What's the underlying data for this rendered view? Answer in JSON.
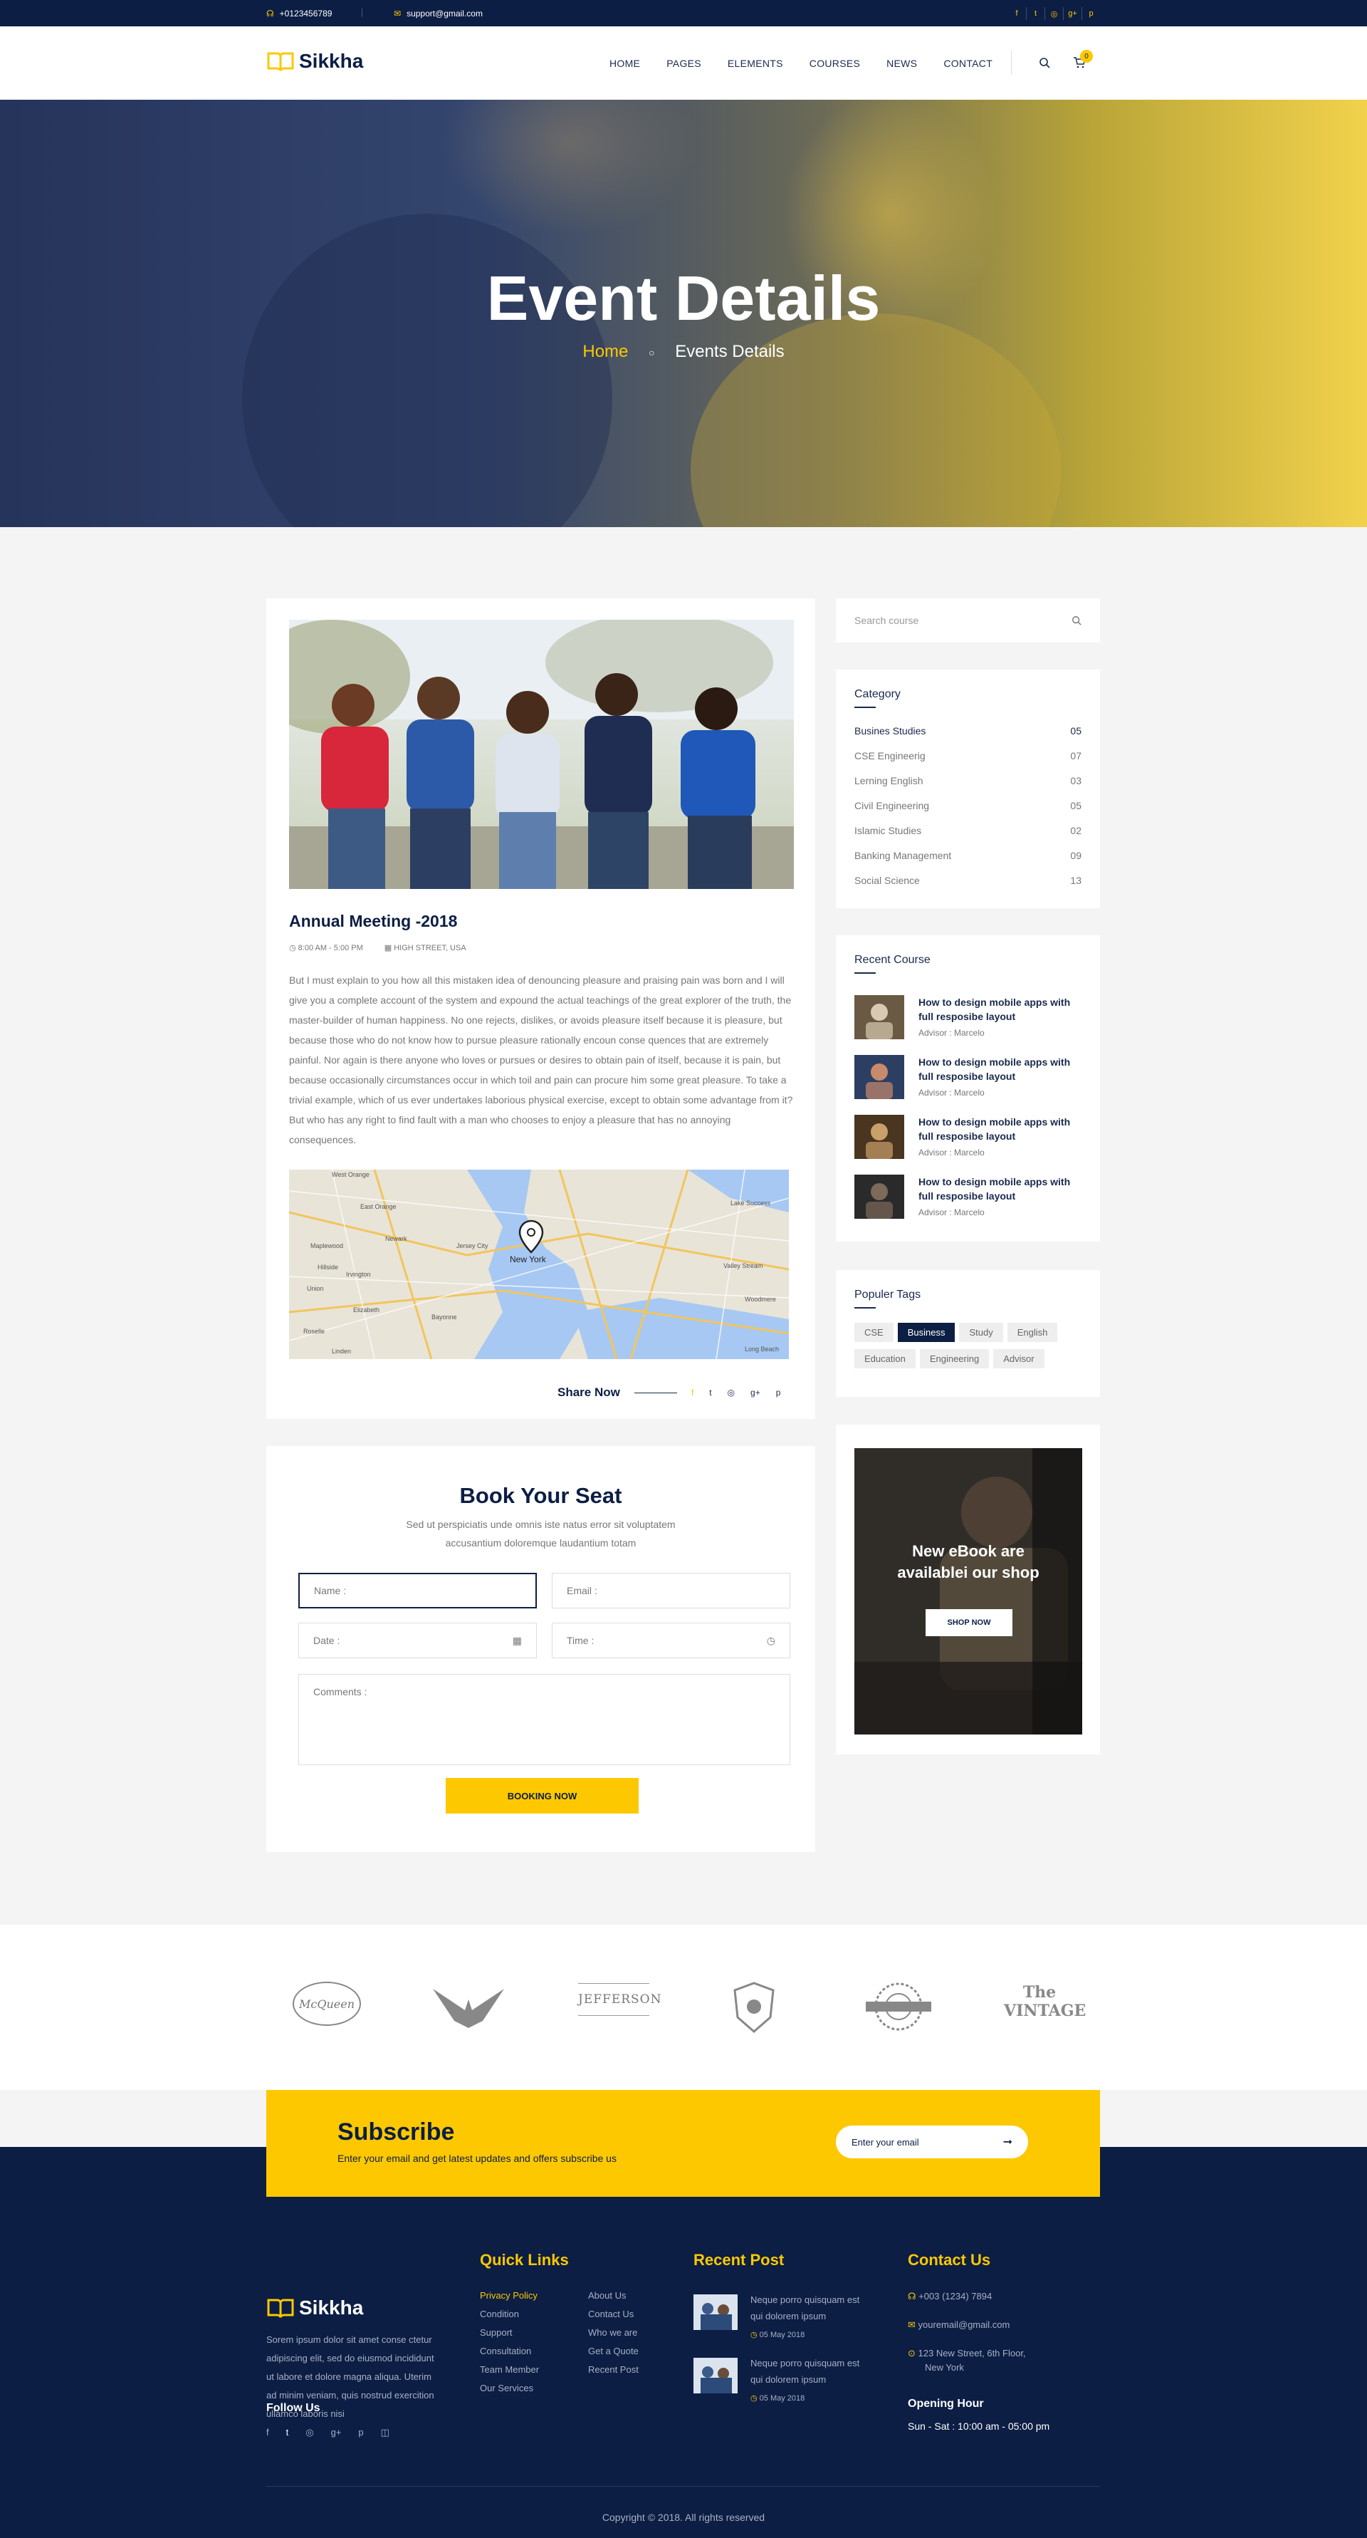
{
  "topbar": {
    "phone": "+0123456789",
    "email": "support@gmail.com",
    "social_icons": [
      "facebook-icon",
      "twitter-icon",
      "dribbble-icon",
      "google-plus-icon",
      "pinterest-icon"
    ]
  },
  "header": {
    "logo": "Sikkha",
    "nav": [
      "HOME",
      "PAGES",
      "ELEMENTS",
      "COURSES",
      "NEWS",
      "CONTACT"
    ],
    "cart_count": "0"
  },
  "hero": {
    "title": "Event Details",
    "crumb_home": "Home",
    "crumb_current": "Events Details"
  },
  "event": {
    "title": "Annual Meeting -2018",
    "time": "8:00 AM - 5:00 PM",
    "location": "HIGH STREET, USA",
    "body": "But I must explain to you how all this mistaken idea of denouncing pleasure and praising pain was born and I will give you a complete account of the system and expound the actual teachings of the great explorer of the truth, the master-builder of human happiness. No one rejects, dislikes, or avoids pleasure itself because it is pleasure, but because those who do not know how to pursue pleasure rationally encoun conse quences that are extremely painful. Nor again is there anyone who loves or pursues or desires to obtain pain of itself, because it is pain, but because occasionally circumstances occur in which toil and pain can procure him some great pleasure. To take a trivial example, which of us ever undertakes laborious physical exercise, except to obtain some advantage from it? But who has any right to find fault with a man who chooses to enjoy a pleasure that has no annoying consequences.",
    "map_labels": [
      "West Orange",
      "East Orange",
      "Newark",
      "Maplewood",
      "Irvington",
      "Elizabeth",
      "Jersey City",
      "New York",
      "Bayonne",
      "Linden",
      "Lake Success",
      "Valley Stream",
      "Woodmere",
      "Long Beach",
      "Roselle",
      "Union",
      "Hillside"
    ],
    "share_label": "Share Now"
  },
  "booking": {
    "title": "Book Your Seat",
    "desc1": "Sed ut perspiciatis unde omnis iste natus error sit voluptatem",
    "desc2": "accusantium doloremque laudantium totam",
    "name_ph": "Name :",
    "email_ph": "Email :",
    "date_ph": "Date :",
    "time_ph": "Time :",
    "comments_ph": "Comments :",
    "button": "BOOKING NOW"
  },
  "sidebar": {
    "search_ph": "Search course",
    "category_title": "Category",
    "categories": [
      {
        "name": "Busines Studies",
        "count": "05"
      },
      {
        "name": "CSE Engineerig",
        "count": "07"
      },
      {
        "name": "Lerning English",
        "count": "03"
      },
      {
        "name": "Civil Engineering",
        "count": "05"
      },
      {
        "name": "Islamic Studies",
        "count": "02"
      },
      {
        "name": "Banking Management",
        "count": "09"
      },
      {
        "name": "Social Science",
        "count": "13"
      }
    ],
    "recent_title": "Recent Course",
    "recent": [
      {
        "title1": "How to design mobile apps with",
        "title2": "full resposibe layout",
        "advisor": "Advisor : Marcelo"
      },
      {
        "title1": "How to design mobile apps with",
        "title2": "full resposibe layout",
        "advisor": "Advisor : Marcelo"
      },
      {
        "title1": "How to design mobile apps with",
        "title2": "full resposibe layout",
        "advisor": "Advisor : Marcelo"
      },
      {
        "title1": "How to design mobile apps with",
        "title2": "full resposibe layout",
        "advisor": "Advisor : Marcelo"
      }
    ],
    "tags_title": "Populer Tags",
    "tags": [
      "CSE",
      "Business",
      "Study",
      "English",
      "Education",
      "Engineering",
      "Advisor"
    ],
    "ebook_line1": "New eBook are",
    "ebook_line2": "availablei our shop",
    "ebook_btn": "SHOP NOW"
  },
  "brands": [
    "McQueen",
    "JEFFERSON",
    "The VINTAGE"
  ],
  "subscribe": {
    "title": "Subscribe",
    "desc": "Enter  your email and get latest updates and offers subscribe us",
    "placeholder": "Enter your email"
  },
  "footer": {
    "logo": "Sikkha",
    "about": [
      "Sorem ipsum dolor sit amet conse ctetur",
      "adipiscing elit, sed do eiusmod  incididunt",
      "ut labore et dolore magna aliqua. Uterim",
      "ad minim veniam, quis nostrud exercition",
      "ullamco laboris nisi"
    ],
    "follow": "Follow Us",
    "quick_title": "Quick Links",
    "quick_col1": [
      "Privacy Policy",
      "Condition",
      "Support",
      "Consultation",
      "Team Member",
      "Our Services"
    ],
    "quick_col2": [
      "About Us",
      "Contact Us",
      "Who we are",
      "Get a Quote",
      "Recent Post"
    ],
    "recent_title": "Recent Post",
    "posts": [
      {
        "l1": "Neque porro quisquam est",
        "l2": "qui dolorem ipsum",
        "date": "05 May 2018"
      },
      {
        "l1": "Neque porro quisquam est",
        "l2": "qui dolorem ipsum",
        "date": "05 May 2018"
      }
    ],
    "contact_title": "Contact Us",
    "phone": "+003 (1234) 7894",
    "email": "youremail@gmail.com",
    "addr1": "123 New Street, 6th Floor,",
    "addr2": "New York",
    "hour_title": "Opening Hour",
    "hours": "Sun - Sat : 10:00 am - 05:00 pm",
    "copyright": "Copyright © 2018. All rights reserved"
  },
  "colors": {
    "navy": "#0c1e44",
    "yellow": "#fdc800"
  }
}
